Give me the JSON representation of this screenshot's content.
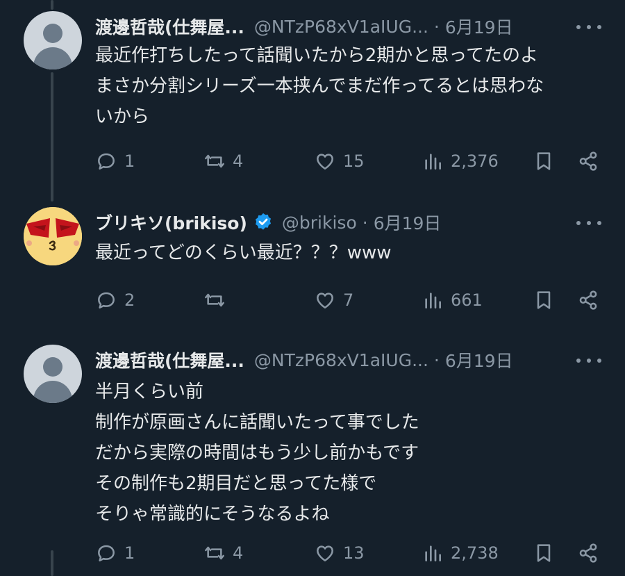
{
  "tweets": [
    {
      "name": "渡邊哲哉(仕舞屋...",
      "handle": "@NTzP68xV1aIUG...",
      "date": "6月19日",
      "lines": [
        "最近作打ちしたって話聞いたから2期かと思ってたのよ",
        "まさか分割シリーズ一本挟んでまだ作ってるとは思わな",
        "いから"
      ],
      "replies": "1",
      "retweets": "4",
      "likes": "15",
      "views": "2,376",
      "verified": false,
      "avatar": "default-avatar"
    },
    {
      "name": "ブリキソ(brikiso)",
      "handle": "@brikiso",
      "date": "6月19日",
      "lines": [
        "最近ってどのくらい最近？？？www"
      ],
      "replies": "2",
      "retweets": "",
      "likes": "7",
      "views": "661",
      "verified": true,
      "avatar": "brikiso-avatar"
    },
    {
      "name": "渡邊哲哉(仕舞屋...",
      "handle": "@NTzP68xV1aIUG...",
      "date": "6月19日",
      "lines": [
        "半月くらい前",
        "制作が原画さんに話聞いたって事でした",
        "だから実際の時間はもう少し前かもです",
        "その制作も2期目だと思ってた様で",
        "そりゃ常識的にそうなるよね"
      ],
      "replies": "1",
      "retweets": "4",
      "likes": "13",
      "views": "2,738",
      "verified": false,
      "avatar": "default-avatar"
    }
  ],
  "colors": {
    "background": "#15202b",
    "text": "#e7e9ea",
    "muted": "#8b98a5",
    "verified": "#1d9bf0",
    "thread_line": "#38444d"
  },
  "icons": [
    "reply-icon",
    "retweet-icon",
    "like-icon",
    "views-icon",
    "bookmark-icon",
    "share-icon",
    "more-icon",
    "verified-icon"
  ]
}
